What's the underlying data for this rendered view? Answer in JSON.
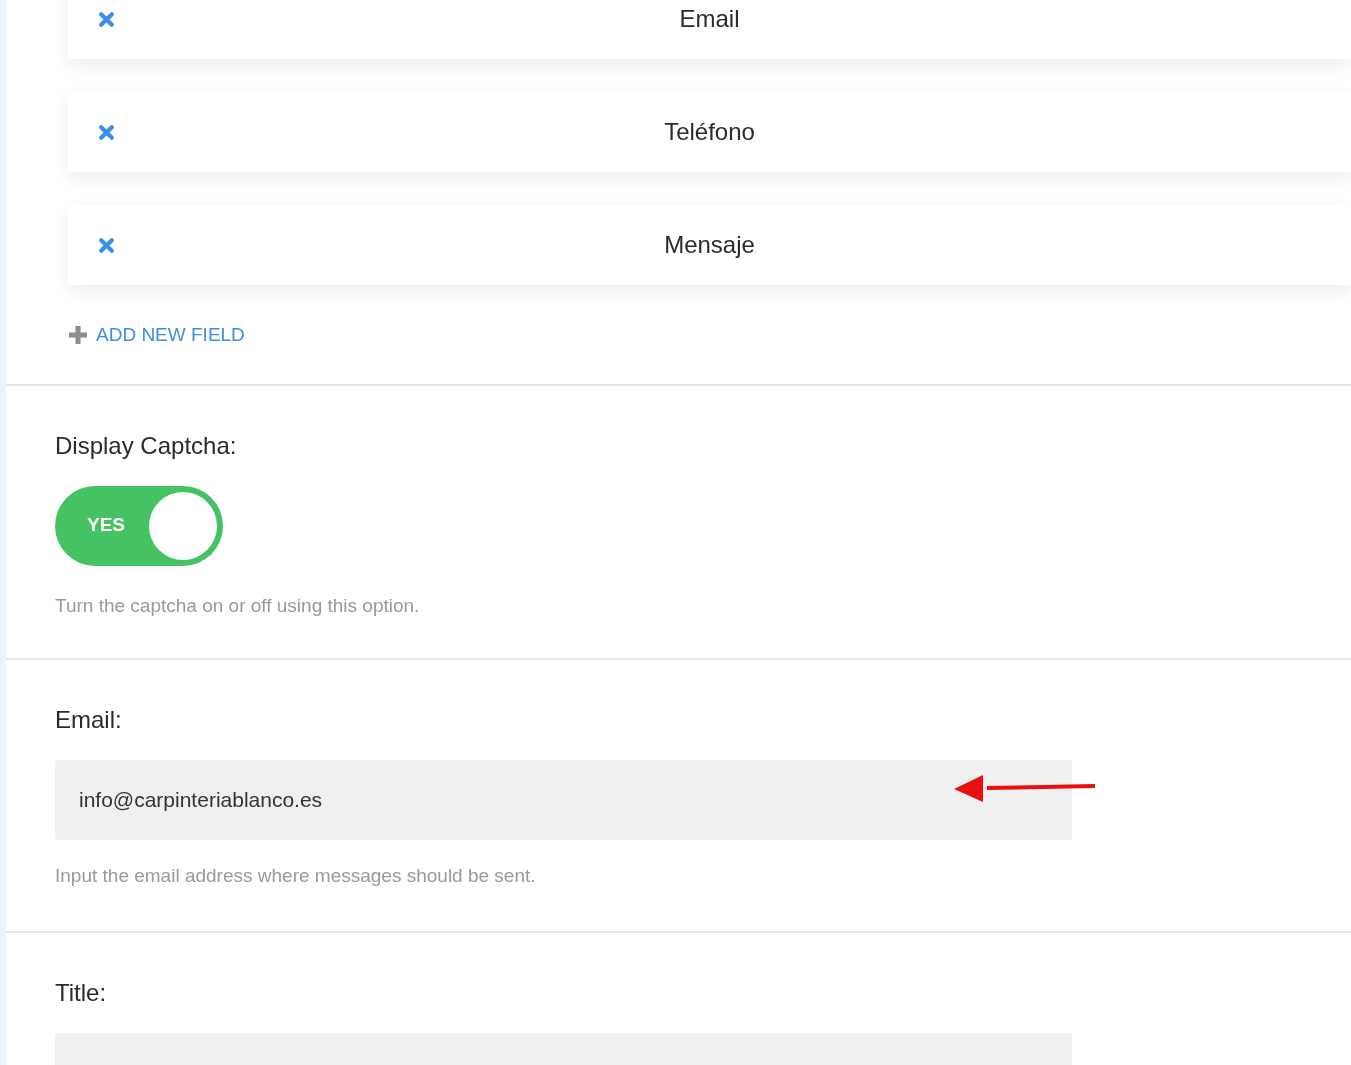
{
  "form_fields": [
    {
      "label": "Email"
    },
    {
      "label": "Teléfono"
    },
    {
      "label": "Mensaje"
    }
  ],
  "add_field": {
    "label": "ADD NEW FIELD"
  },
  "captcha": {
    "label": "Display Captcha:",
    "toggle": {
      "on": true,
      "text": "YES"
    },
    "help": "Turn the captcha on or off using this option."
  },
  "email": {
    "label": "Email:",
    "value": "info@carpinteriablanco.es",
    "help": "Input the email address where messages should be sent."
  },
  "title": {
    "label": "Title:"
  }
}
